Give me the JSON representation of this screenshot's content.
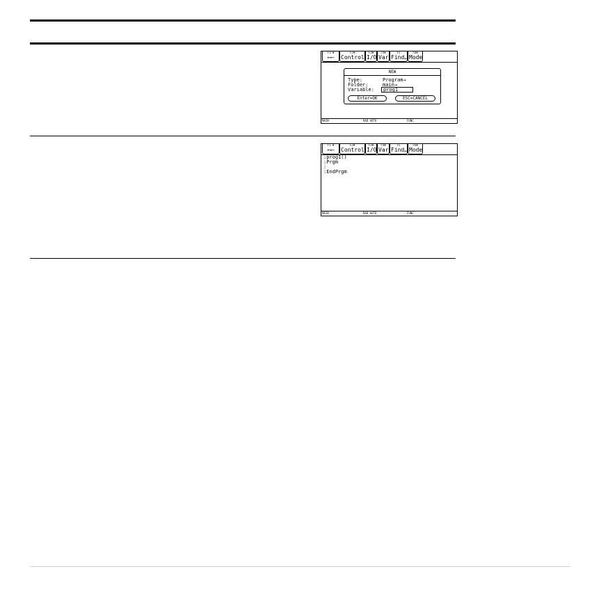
{
  "toolbar": {
    "tabs": [
      {
        "fkey": "F1 ▼",
        "label": "←⟵"
      },
      {
        "fkey": "F2▼",
        "label": "Control"
      },
      {
        "fkey": "F3▼",
        "label": "I/O"
      },
      {
        "fkey": "F4▼",
        "label": "Var"
      },
      {
        "fkey": "F5",
        "label": "Find…"
      },
      {
        "fkey": "F6▼",
        "label": "Mode"
      }
    ]
  },
  "status": {
    "left": "MAIN",
    "mid": "RAD AUTO",
    "right": "FUNC"
  },
  "dialog": {
    "title": "NEW",
    "type_label": "Type:",
    "type_value": "Program→",
    "folder_label": "Folder:",
    "folder_value": "main→",
    "variable_label": "Variable:",
    "variable_value": "prog1",
    "ok_button": "Enter=OK",
    "cancel_button": "ESC=CANCEL"
  },
  "editor": {
    "lines": [
      ":prog1()",
      ":Prgm",
      ":",
      ":EndPrgm"
    ]
  }
}
